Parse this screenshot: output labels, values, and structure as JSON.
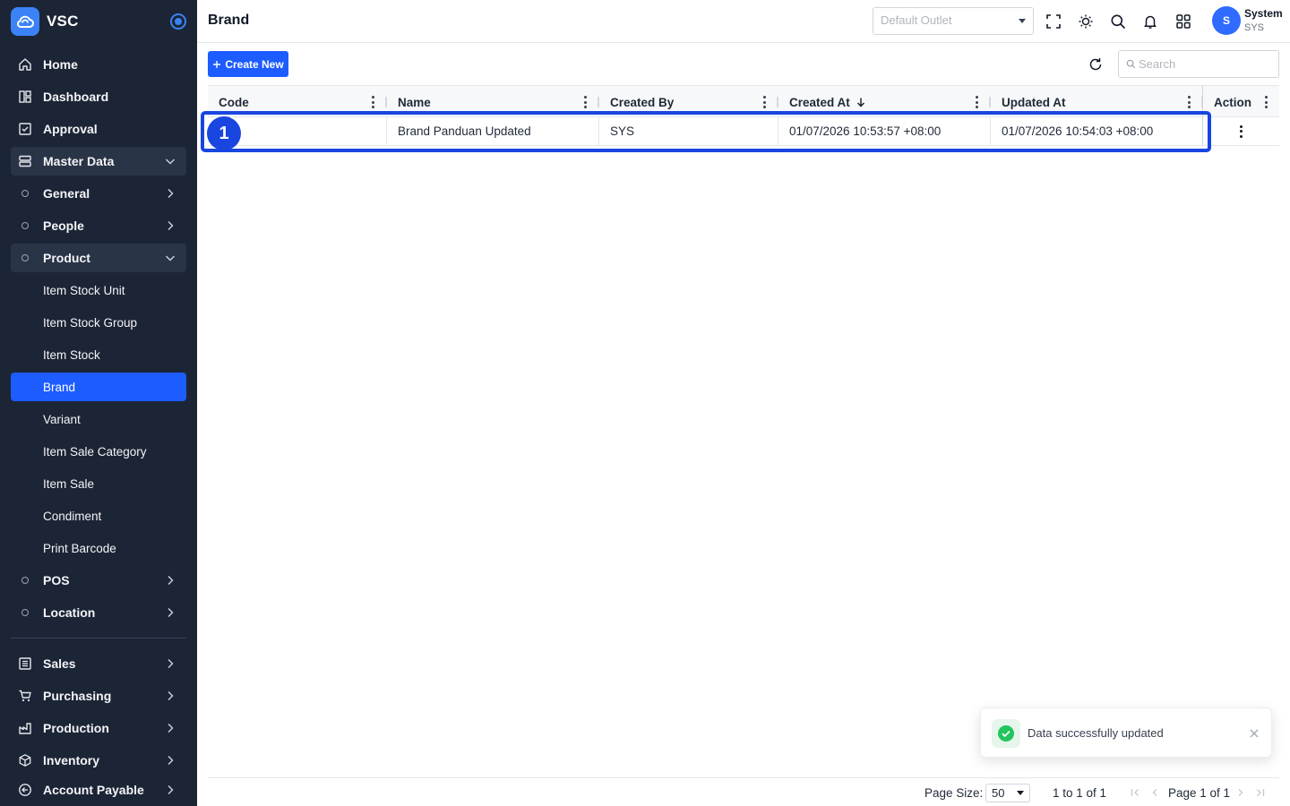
{
  "app": {
    "name": "VSC"
  },
  "header": {
    "page_title": "Brand",
    "outlet_placeholder": "Default Outlet",
    "user_initial": "S",
    "user_name": "System",
    "user_code": "SYS"
  },
  "sidebar": {
    "home": "Home",
    "dashboard": "Dashboard",
    "approval": "Approval",
    "master_data": "Master Data",
    "general": "General",
    "people": "People",
    "product": "Product",
    "product_items": [
      "Item Stock Unit",
      "Item Stock Group",
      "Item Stock",
      "Brand",
      "Variant",
      "Item Sale Category",
      "Item Sale",
      "Condiment",
      "Print Barcode"
    ],
    "pos": "POS",
    "location": "Location",
    "sales": "Sales",
    "purchasing": "Purchasing",
    "production": "Production",
    "inventory": "Inventory",
    "account_payable": "Account Payable"
  },
  "toolbar": {
    "create_label": "Create New",
    "search_placeholder": "Search"
  },
  "grid": {
    "columns": [
      "Code",
      "Name",
      "Created By",
      "Created At",
      "Updated At",
      "Action"
    ],
    "sorted_column": "Created At",
    "sort_direction": "desc",
    "rows": [
      {
        "code": "",
        "name": "Brand Panduan Updated",
        "created_by": "SYS",
        "created_at": "01/07/2026 10:53:57 +08:00",
        "updated_at": "01/07/2026 10:54:03 +08:00"
      }
    ]
  },
  "annotation": {
    "step": "1"
  },
  "pager": {
    "page_size_label": "Page Size:",
    "page_size": "50",
    "range_text": "1 to 1 of 1",
    "page_text": "Page 1 of 1"
  },
  "toast": {
    "message": "Data successfully updated"
  },
  "colors": {
    "primary": "#1d5cff",
    "sidebar": "#1c2536",
    "success": "#22c55e"
  }
}
